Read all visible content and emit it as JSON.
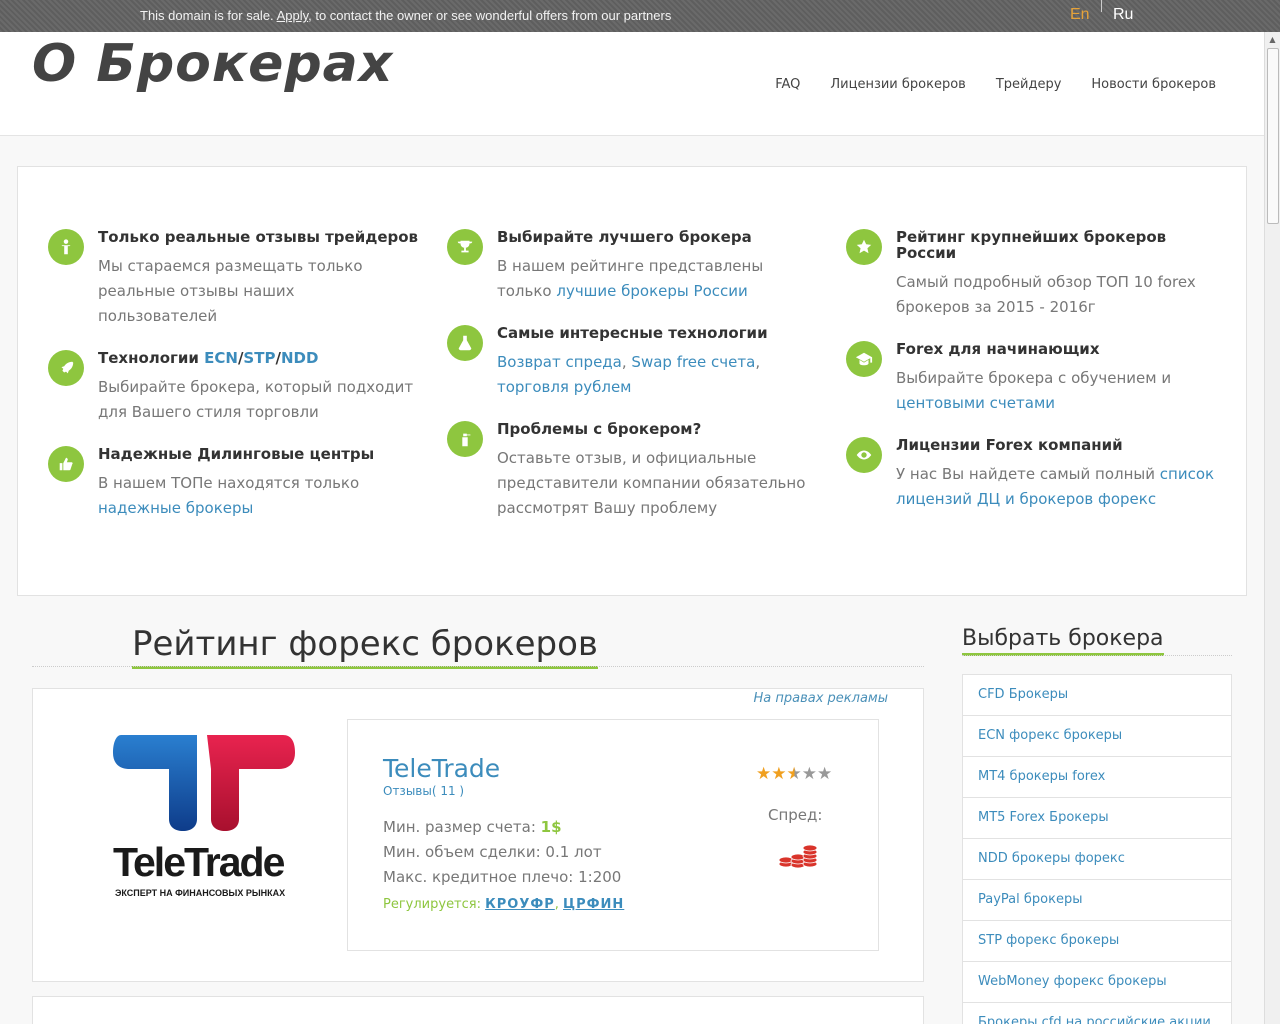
{
  "salebar": {
    "message_prefix": "This domain is for sale. ",
    "apply_link": "Apply",
    "message_suffix": ", to contact the owner or see wonderful offers from our partners",
    "lang_en": "En",
    "lang_ru": "Ru"
  },
  "header": {
    "logo": "О Брокерах",
    "nav": [
      "FAQ",
      "Лицензии брокеров",
      "Трейдеру",
      "Новости брокеров"
    ]
  },
  "features": {
    "col1": [
      {
        "icon": "person-icon",
        "title": "Только реальные отзывы трейдеров",
        "text": "Мы стараемся размещать только реальные отзывы наших пользователей"
      },
      {
        "icon": "rocket-icon",
        "title_prefix": "Технологии ",
        "title_links": [
          "ECN",
          "STP",
          "NDD"
        ],
        "text": "Выбирайте брокера, который подходит для Вашего стиля торговли"
      },
      {
        "icon": "thumbs-up-icon",
        "title": "Надежные Дилинговые центры",
        "text": "В нашем ТОПе находятся только ",
        "link": "надежные брокеры"
      }
    ],
    "col2": [
      {
        "icon": "trophy-icon",
        "title": "Выбирайте лучшего брокера",
        "text": "В нашем рейтинге представлены только ",
        "link": "лучшие брокеры России"
      },
      {
        "icon": "flask-icon",
        "title": "Самые интересные технологии",
        "links": [
          "Возврат спреда",
          "Swap free счета",
          "торговля рублем"
        ]
      },
      {
        "icon": "spray-icon",
        "title": "Проблемы с брокером?",
        "text": "Оставьте отзыв, и официальные представители компании обязательно рассмотрят Вашу проблему"
      }
    ],
    "col3": [
      {
        "icon": "star-icon",
        "title": "Рейтинг крупнейших брокеров России",
        "text": "Самый подробный обзор ТОП 10 forex брокеров за 2015 - 2016г"
      },
      {
        "icon": "graduation-cap-icon",
        "title": "Forex для начинающих",
        "text": "Выбирайте брокера с обучением и ",
        "link": "центовыми счетами"
      },
      {
        "icon": "eye-icon",
        "title": "Лицензии Forex компаний",
        "text": "У нас Вы найдете самый полный ",
        "link": "список лицензий ДЦ и брокеров форекс"
      }
    ]
  },
  "main": {
    "title": "Рейтинг форекс брокеров",
    "ad_note": "На правах рекламы",
    "broker": {
      "logo_word": "TeleTrade",
      "logo_sub": "ЭКСПЕРТ НА ФИНАНСОВЫХ РЫНКАХ",
      "name": "TeleTrade",
      "reviews": "Отзывы( 11 )",
      "min_deposit_label": "Мин. размер счета: ",
      "min_deposit_value": "1$",
      "min_lot": "Мин. объем сделки: 0.1 лот",
      "leverage": "Макс. кредитное плечо: 1:200",
      "regulated_label": "Регулируется: ",
      "regulators": [
        "КРОУФР",
        "ЦРФИН"
      ],
      "rating": 2.5,
      "rating_max": 5,
      "spread_label": "Спред:"
    }
  },
  "sidebar": {
    "title": "Выбрать брокера",
    "items": [
      "CFD Брокеры",
      "ECN форекс брокеры",
      "MT4 брокеры forex",
      "MT5 Forex Брокеры",
      "NDD брокеры форекс",
      "PayPal брокеры",
      "STP форекс брокеры",
      "WebMoney форекс брокеры",
      "Брокеры cfd на российские акции"
    ]
  },
  "colors": {
    "accent_green": "#8ec63f",
    "link_blue": "#3c8cbc",
    "brand_blue": "#1f5fa8",
    "brand_red": "#d7143c"
  }
}
